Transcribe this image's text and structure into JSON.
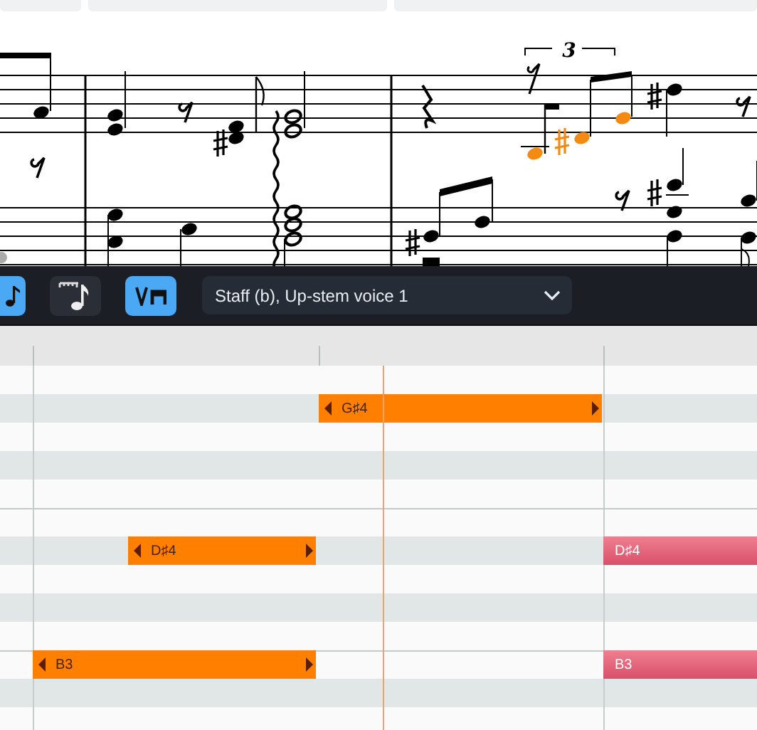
{
  "score": {
    "tuplet_number": "3"
  },
  "toolbar": {
    "buttons": [
      {
        "kind": "note",
        "selected": true
      },
      {
        "kind": "ruler-note",
        "selected": false
      },
      {
        "kind": "bowing",
        "selected": true
      }
    ],
    "voice_dropdown": {
      "value": "Staff (b), Up-stem voice 1"
    }
  },
  "piano_roll": {
    "notes": [
      {
        "label": "G♯4",
        "selected": true
      },
      {
        "label": "D♯4",
        "selected": true
      },
      {
        "label": "B3",
        "selected": true
      },
      {
        "label": "D♯4",
        "selected": false
      },
      {
        "label": "B3",
        "selected": false
      }
    ]
  }
}
